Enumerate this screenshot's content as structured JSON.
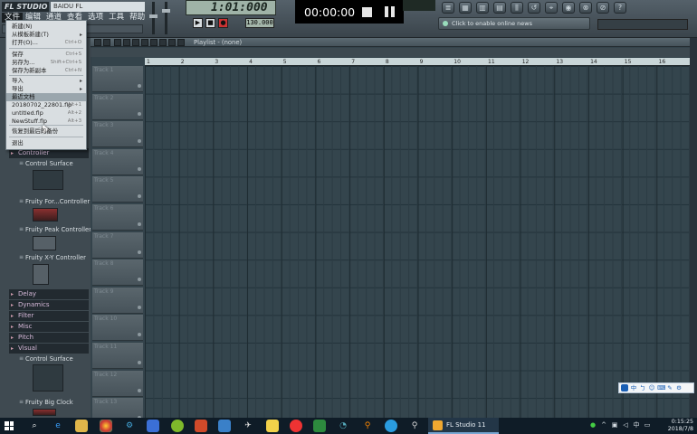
{
  "window": {
    "brand": "FL STUDIO",
    "project": "BAIDU FL"
  },
  "menubar": [
    "文件",
    "编辑",
    "通道",
    "查看",
    "选项",
    "工具",
    "帮助"
  ],
  "transport": {
    "time": "1:01:000",
    "bpm": "130.000"
  },
  "recorder": {
    "timer": "00:00:00"
  },
  "news": "Click to enable online news",
  "file_menu": {
    "items": [
      {
        "label": "新建(N)",
        "shortcut": ""
      },
      {
        "label": "从模板新建(T)",
        "shortcut": "",
        "submenu": true
      },
      {
        "label": "打开(O)...",
        "shortcut": "Ctrl+O"
      },
      {
        "label": "保存",
        "shortcut": "Ctrl+S"
      },
      {
        "label": "另存为...",
        "shortcut": "Shift+Ctrl+S"
      },
      {
        "label": "保存为新副本",
        "shortcut": "Ctrl+N"
      },
      {
        "label": "导入",
        "shortcut": "",
        "submenu": true
      },
      {
        "label": "导出",
        "shortcut": "",
        "submenu": true
      },
      {
        "label": "最近文档",
        "shortcut": ""
      },
      {
        "label": "20180702_22801.flp",
        "shortcut": "Alt+1"
      },
      {
        "label": "untitled.flp",
        "shortcut": "Alt+2"
      },
      {
        "label": "NewStuff.flp",
        "shortcut": "Alt+3"
      },
      {
        "label": "恢复到最后的备份",
        "shortcut": ""
      },
      {
        "label": "退出",
        "shortcut": ""
      }
    ]
  },
  "browser": {
    "categories": [
      "Controller",
      "Delay",
      "Dynamics",
      "Filter",
      "Misc",
      "Pitch",
      "Visual"
    ],
    "plugins": [
      "Control Surface",
      "Fruity For...Controller",
      "Fruity Peak Controller",
      "Fruity X-Y Controller",
      "Control Surface",
      "Fruity Big Clock"
    ]
  },
  "playlist": {
    "title": "Playlist - (none)",
    "ruler": [
      "1",
      "2",
      "3",
      "4",
      "5",
      "6",
      "7",
      "8",
      "9",
      "10",
      "11",
      "12",
      "13",
      "14",
      "15",
      "16"
    ],
    "tracks": [
      "Track 1",
      "Track 2",
      "Track 3",
      "Track 4",
      "Track 5",
      "Track 6",
      "Track 7",
      "Track 8",
      "Track 9",
      "Track 10",
      "Track 11",
      "Track 12",
      "Track 13"
    ]
  },
  "ime": [
    "中",
    "ㄅ",
    "☺",
    "⌨",
    "✎",
    "⚙"
  ],
  "taskbar": {
    "active_app": "FL Studio 11",
    "time": "0:15:25",
    "date": "2018/7/8",
    "tray_ime": "中"
  }
}
